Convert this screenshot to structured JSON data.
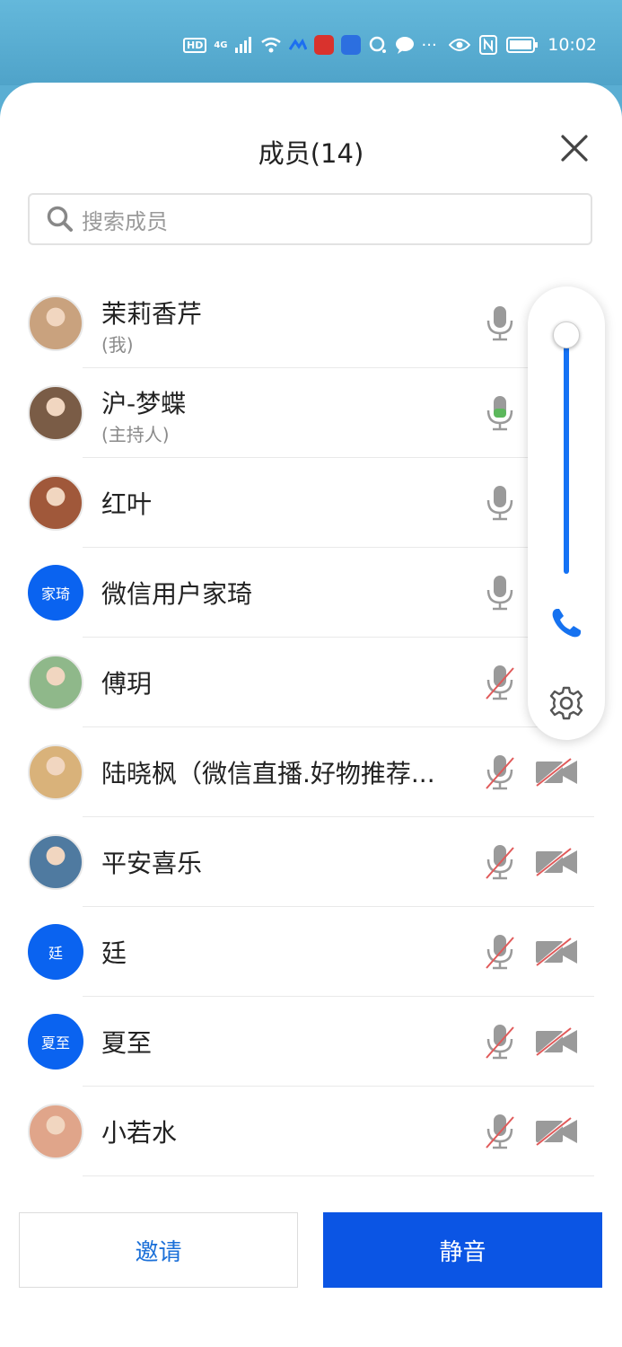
{
  "status_bar": {
    "time": "10:02",
    "hd_label": "HD",
    "network_label": "4G",
    "more_label": "···"
  },
  "header": {
    "title": "成员(14)"
  },
  "search": {
    "placeholder": "搜索成员"
  },
  "members": [
    {
      "name": "茉莉香芹",
      "sub": "(我)",
      "avatar_text": "",
      "mic": "on",
      "cam": "off"
    },
    {
      "name": "沪-梦蝶",
      "sub": "(主持人)",
      "avatar_text": "",
      "mic": "on-active",
      "cam": "off"
    },
    {
      "name": "红叶",
      "sub": "",
      "avatar_text": "",
      "mic": "on",
      "cam": "off"
    },
    {
      "name": "微信用户家琦",
      "sub": "",
      "avatar_text": "家琦",
      "mic": "on",
      "cam": "off"
    },
    {
      "name": "傅玥",
      "sub": "",
      "avatar_text": "",
      "mic": "muted",
      "cam": "off"
    },
    {
      "name": "陆晓枫（微信直播.好物推荐...",
      "sub": "",
      "avatar_text": "",
      "mic": "muted",
      "cam": "off"
    },
    {
      "name": "平安喜乐",
      "sub": "",
      "avatar_text": "",
      "mic": "muted",
      "cam": "off"
    },
    {
      "name": "廷",
      "sub": "",
      "avatar_text": "廷",
      "mic": "muted",
      "cam": "off"
    },
    {
      "name": "夏至",
      "sub": "",
      "avatar_text": "夏至",
      "mic": "muted",
      "cam": "off"
    },
    {
      "name": "小若水",
      "sub": "",
      "avatar_text": "",
      "mic": "muted",
      "cam": "off"
    }
  ],
  "side_panel": {
    "volume_level": 1.0
  },
  "footer": {
    "invite_label": "邀请",
    "mute_label": "静音"
  },
  "colors": {
    "accent": "#0b55e4",
    "avatar_blue": "#0a63f0",
    "mic_active": "#5cb85c",
    "muted_red": "#e05a5a"
  }
}
